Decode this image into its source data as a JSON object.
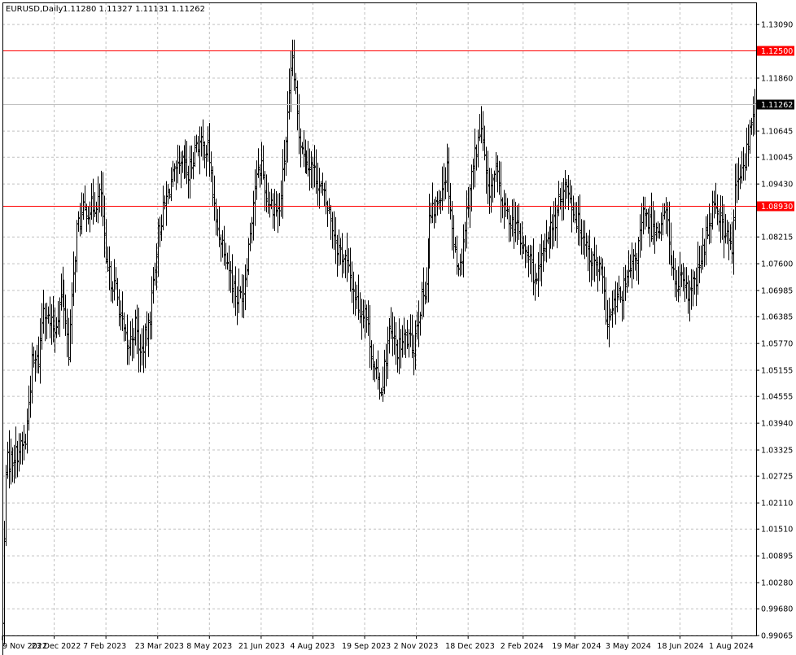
{
  "window": {
    "symbol_label": "EURUSD,Daily",
    "ohlc_label": "1.11280 1.11327 1.11131 1.11262"
  },
  "colors": {
    "background": "#ffffff",
    "grid": "#c0c0c0",
    "bars": "#000000",
    "level_line": "#ff0000",
    "current_price_line": "#c0c0c0",
    "badge_text": "#ffffff"
  },
  "chart_data": {
    "type": "ohlc",
    "timeframe": "Daily",
    "symbol": "EURUSD",
    "grid": true,
    "ylim": [
      0.99068,
      1.13597
    ],
    "y_ticks": [
      "1.13090",
      "1.12500",
      "1.11860",
      "1.11262",
      "1.10645",
      "1.10045",
      "1.09430",
      "1.08930",
      "1.08215",
      "1.07600",
      "1.06985",
      "1.06385",
      "1.05770",
      "1.05155",
      "1.04555",
      "1.03940",
      "1.03325",
      "1.02725",
      "1.02110",
      "1.01510",
      "1.00895",
      "1.00280",
      "0.99680",
      "0.99065"
    ],
    "x_ticks": [
      "9 Nov 2022",
      "23 Dec 2022",
      "7 Feb 2023",
      "23 Mar 2023",
      "8 May 2023",
      "21 Jun 2023",
      "4 Aug 2023",
      "19 Sep 2023",
      "2 Nov 2023",
      "18 Dec 2023",
      "2 Feb 2024",
      "19 Mar 2024",
      "3 May 2024",
      "18 Jun 2024",
      "1 Aug 2024"
    ],
    "horizontal_levels": [
      {
        "value": 1.125,
        "label": "1.12500",
        "color": "#ff0000"
      },
      {
        "value": 1.0893,
        "label": "1.08930",
        "color": "#ff0000"
      }
    ],
    "current_price": {
      "value": 1.11262,
      "label": "1.11262"
    },
    "close_path": [
      [
        "9 Nov 2022",
        0.993
      ],
      [
        "11 Nov 2022",
        1.03
      ],
      [
        "18 Nov 2022",
        1.032
      ],
      [
        "29 Nov 2022",
        1.035
      ],
      [
        "5 Dec 2022",
        1.053
      ],
      [
        "9 Dec 2022",
        1.054
      ],
      [
        "14 Dec 2022",
        1.067
      ],
      [
        "20 Dec 2022",
        1.062
      ],
      [
        "23 Dec 2022",
        1.061
      ],
      [
        "30 Dec 2022",
        1.07
      ],
      [
        "5 Jan 2023",
        1.056
      ],
      [
        "12 Jan 2023",
        1.084
      ],
      [
        "18 Jan 2023",
        1.088
      ],
      [
        "26 Jan 2023",
        1.089
      ],
      [
        "2 Feb 2023",
        1.092
      ],
      [
        "7 Feb 2023",
        1.075
      ],
      [
        "15 Feb 2023",
        1.07
      ],
      [
        "24 Feb 2023",
        1.056
      ],
      [
        "3 Mar 2023",
        1.062
      ],
      [
        "8 Mar 2023",
        1.055
      ],
      [
        "15 Mar 2023",
        1.061
      ],
      [
        "23 Mar 2023",
        1.083
      ],
      [
        "28 Mar 2023",
        1.088
      ],
      [
        "4 Apr 2023",
        1.095
      ],
      [
        "14 Apr 2023",
        1.099
      ],
      [
        "19 Apr 2023",
        1.096
      ],
      [
        "26 Apr 2023",
        1.104
      ],
      [
        "5 May 2023",
        1.102
      ],
      [
        "8 May 2023",
        1.1
      ],
      [
        "12 May 2023",
        1.085
      ],
      [
        "19 May 2023",
        1.08
      ],
      [
        "26 May 2023",
        1.072
      ],
      [
        "31 May 2023",
        1.068
      ],
      [
        "6 Jun 2023",
        1.07
      ],
      [
        "15 Jun 2023",
        1.094
      ],
      [
        "21 Jun 2023",
        1.099
      ],
      [
        "26 Jun 2023",
        1.091
      ],
      [
        "6 Jul 2023",
        1.088
      ],
      [
        "11 Jul 2023",
        1.1
      ],
      [
        "18 Jul 2023",
        1.123
      ],
      [
        "24 Jul 2023",
        1.106
      ],
      [
        "28 Jul 2023",
        1.101
      ],
      [
        "4 Aug 2023",
        1.098
      ],
      [
        "10 Aug 2023",
        1.094
      ],
      [
        "18 Aug 2023",
        1.088
      ],
      [
        "25 Aug 2023",
        1.08
      ],
      [
        "1 Sep 2023",
        1.077
      ],
      [
        "8 Sep 2023",
        1.07
      ],
      [
        "14 Sep 2023",
        1.065
      ],
      [
        "19 Sep 2023",
        1.066
      ],
      [
        "27 Sep 2023",
        1.051
      ],
      [
        "3 Oct 2023",
        1.047
      ],
      [
        "10 Oct 2023",
        1.06
      ],
      [
        "17 Oct 2023",
        1.056
      ],
      [
        "24 Oct 2023",
        1.059
      ],
      [
        "31 Oct 2023",
        1.057
      ],
      [
        "2 Nov 2023",
        1.063
      ],
      [
        "10 Nov 2023",
        1.072
      ],
      [
        "14 Nov 2023",
        1.086
      ],
      [
        "21 Nov 2023",
        1.09
      ],
      [
        "29 Nov 2023",
        1.098
      ],
      [
        "5 Dec 2023",
        1.08
      ],
      [
        "11 Dec 2023",
        1.075
      ],
      [
        "18 Dec 2023",
        1.091
      ],
      [
        "22 Dec 2023",
        1.101
      ],
      [
        "28 Dec 2023",
        1.107
      ],
      [
        "3 Jan 2024",
        1.092
      ],
      [
        "10 Jan 2024",
        1.097
      ],
      [
        "17 Jan 2024",
        1.088
      ],
      [
        "26 Jan 2024",
        1.085
      ],
      [
        "2 Feb 2024",
        1.079
      ],
      [
        "8 Feb 2024",
        1.077
      ],
      [
        "14 Feb 2024",
        1.071
      ],
      [
        "22 Feb 2024",
        1.082
      ],
      [
        "1 Mar 2024",
        1.086
      ],
      [
        "8 Mar 2024",
        1.094
      ],
      [
        "13 Mar 2024",
        1.093
      ],
      [
        "19 Mar 2024",
        1.087
      ],
      [
        "26 Mar 2024",
        1.083
      ],
      [
        "2 Apr 2024",
        1.077
      ],
      [
        "10 Apr 2024",
        1.074
      ],
      [
        "16 Apr 2024",
        1.062
      ],
      [
        "23 Apr 2024",
        1.067
      ],
      [
        "30 Apr 2024",
        1.07
      ],
      [
        "3 May 2024",
        1.073
      ],
      [
        "10 May 2024",
        1.078
      ],
      [
        "16 May 2024",
        1.087
      ],
      [
        "24 May 2024",
        1.084
      ],
      [
        "31 May 2024",
        1.085
      ],
      [
        "5 Jun 2024",
        1.088
      ],
      [
        "11 Jun 2024",
        1.075
      ],
      [
        "14 Jun 2024",
        1.07
      ],
      [
        "18 Jun 2024",
        1.072
      ],
      [
        "25 Jun 2024",
        1.069
      ],
      [
        "2 Jul 2024",
        1.072
      ],
      [
        "10 Jul 2024",
        1.082
      ],
      [
        "17 Jul 2024",
        1.091
      ],
      [
        "24 Jul 2024",
        1.085
      ],
      [
        "29 Jul 2024",
        1.082
      ],
      [
        "1 Aug 2024",
        1.079
      ],
      [
        "5 Aug 2024",
        1.093
      ],
      [
        "12 Aug 2024",
        1.098
      ],
      [
        "16 Aug 2024",
        1.106
      ],
      [
        "21 Aug 2024",
        1.11262
      ]
    ]
  }
}
